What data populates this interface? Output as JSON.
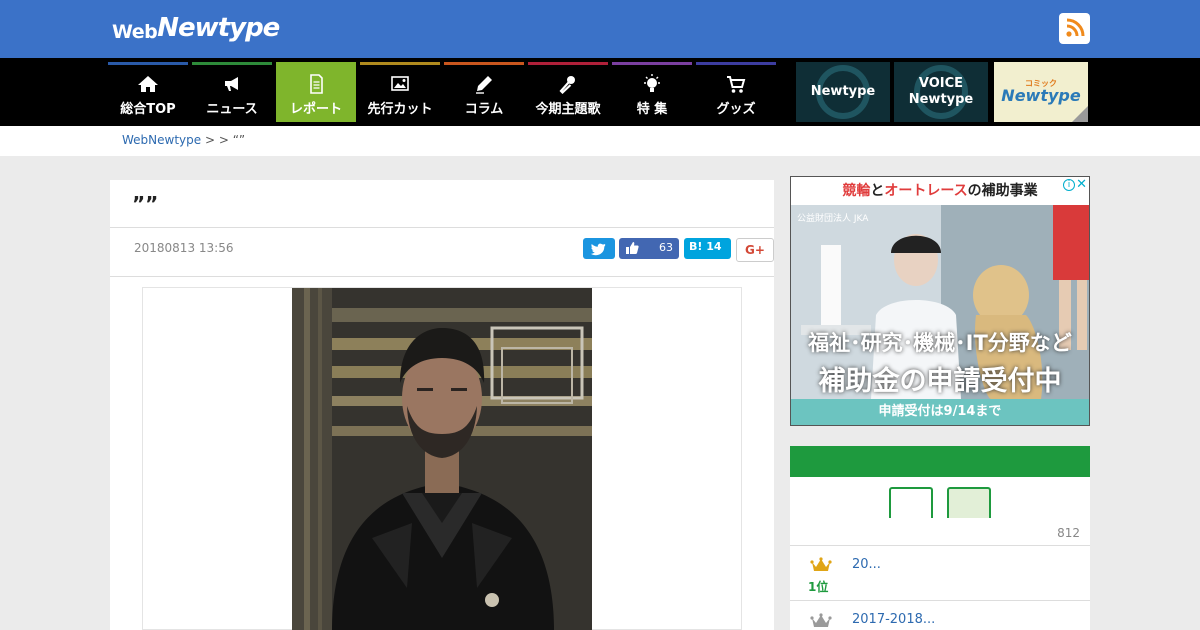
{
  "header": {
    "logo_web": "Web",
    "logo_newtype": "Newtype",
    "rss": "rss-icon"
  },
  "nav": {
    "items": [
      {
        "label": "総合TOP",
        "icon": "home-icon",
        "color": "#2a5aa8"
      },
      {
        "label": "ニュース",
        "icon": "megaphone-icon",
        "color": "#2e8b3a"
      },
      {
        "label": "レポート",
        "icon": "document-icon",
        "color": "#7fb52c"
      },
      {
        "label": "先行カット",
        "icon": "image-icon",
        "color": "#b08a1e"
      },
      {
        "label": "コラム",
        "icon": "pen-icon",
        "color": "#c9561e"
      },
      {
        "label": "今期主題歌",
        "icon": "microphone-icon",
        "color": "#b0203a"
      },
      {
        "label": "特 集",
        "icon": "lightbulb-icon",
        "color": "#7b3fa0"
      },
      {
        "label": "グッズ",
        "icon": "cart-icon",
        "color": "#3d3da0"
      }
    ],
    "active_index": 2,
    "banners": {
      "newtype": "Newtype",
      "voice_line1": "VOICE",
      "voice_line2": "Newtype",
      "comic_top": "コミック",
      "comic_main": "Newtype"
    }
  },
  "breadcrumb": {
    "home": "WebNewtype",
    "sep1": " > ",
    "sep2": " > ",
    "current": "“”"
  },
  "article": {
    "title": "””",
    "date": "20180813 13:56",
    "share": {
      "like_count": "63",
      "hatena_count": "14",
      "gplus": "G+"
    }
  },
  "ad": {
    "head_red1": "競輪",
    "head_mid": "と",
    "head_red2": "オートレース",
    "head_tail": "の補助事業",
    "org": "公益財団法人 JKA",
    "line1": "福祉･研究･機械･IT分野など",
    "line2": "補助金の申請受付中",
    "footer": "申請受付は9/14まで"
  },
  "ranking": {
    "count": "812",
    "items": [
      {
        "position": "1位",
        "title": "20..."
      },
      {
        "position": "",
        "title": "2017-2018..."
      }
    ]
  },
  "colors": {
    "header_blue": "#3b72c8",
    "ranking_green": "#1e9a3e",
    "link_blue": "#2d6ab0"
  }
}
